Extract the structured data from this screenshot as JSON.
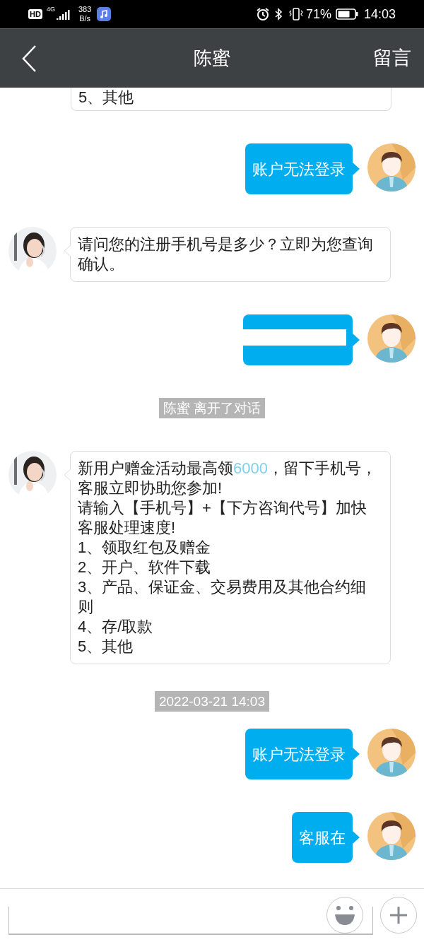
{
  "status_bar": {
    "network": "4G",
    "hd": "HD",
    "speed_value": "383",
    "speed_unit": "B/s",
    "battery": "71%",
    "time": "14:03"
  },
  "header": {
    "title": "陈蜜",
    "action": "留言"
  },
  "messages": [
    {
      "kind": "agent_partial",
      "paragraphs": [
        [
          {
            "text": "5、其他",
            "highlight": false
          }
        ]
      ]
    },
    {
      "kind": "user",
      "text": "账户无法登录"
    },
    {
      "kind": "agent",
      "paragraphs": [
        [
          {
            "text": "请问您的注册手机号是多少？立即为您查询",
            "highlight": false
          }
        ],
        [
          {
            "text": "确认。",
            "highlight": false
          }
        ]
      ]
    },
    {
      "kind": "user_redacted"
    },
    {
      "kind": "system",
      "text": "陈蜜 离开了对话"
    },
    {
      "kind": "agent",
      "paragraphs": [
        [
          {
            "text": "新用户赠金活动最高领",
            "highlight": false
          },
          {
            "text": "6000",
            "highlight": true
          },
          {
            "text": "，留下手机号，",
            "highlight": false
          }
        ],
        [
          {
            "text": "客服立即协助您参加!",
            "highlight": false
          }
        ],
        [
          {
            "text": "请输入【手机号】+【下方咨询代号】加快",
            "highlight": false
          }
        ],
        [
          {
            "text": "客服处理速度!",
            "highlight": false
          }
        ],
        [
          {
            "text": "1、领取红包及赠金",
            "highlight": false
          }
        ],
        [
          {
            "text": "2、开户、软件下载",
            "highlight": false
          }
        ],
        [
          {
            "text": "3、产品、保证金、交易费用及其他合约细",
            "highlight": false
          }
        ],
        [
          {
            "text": "则",
            "highlight": false
          }
        ],
        [
          {
            "text": "4、存/取款",
            "highlight": false
          }
        ],
        [
          {
            "text": "5、其他",
            "highlight": false
          }
        ]
      ]
    },
    {
      "kind": "time",
      "text": "2022-03-21 14:03"
    },
    {
      "kind": "user",
      "text": "账户无法登录"
    },
    {
      "kind": "user",
      "text": "客服在"
    }
  ]
}
